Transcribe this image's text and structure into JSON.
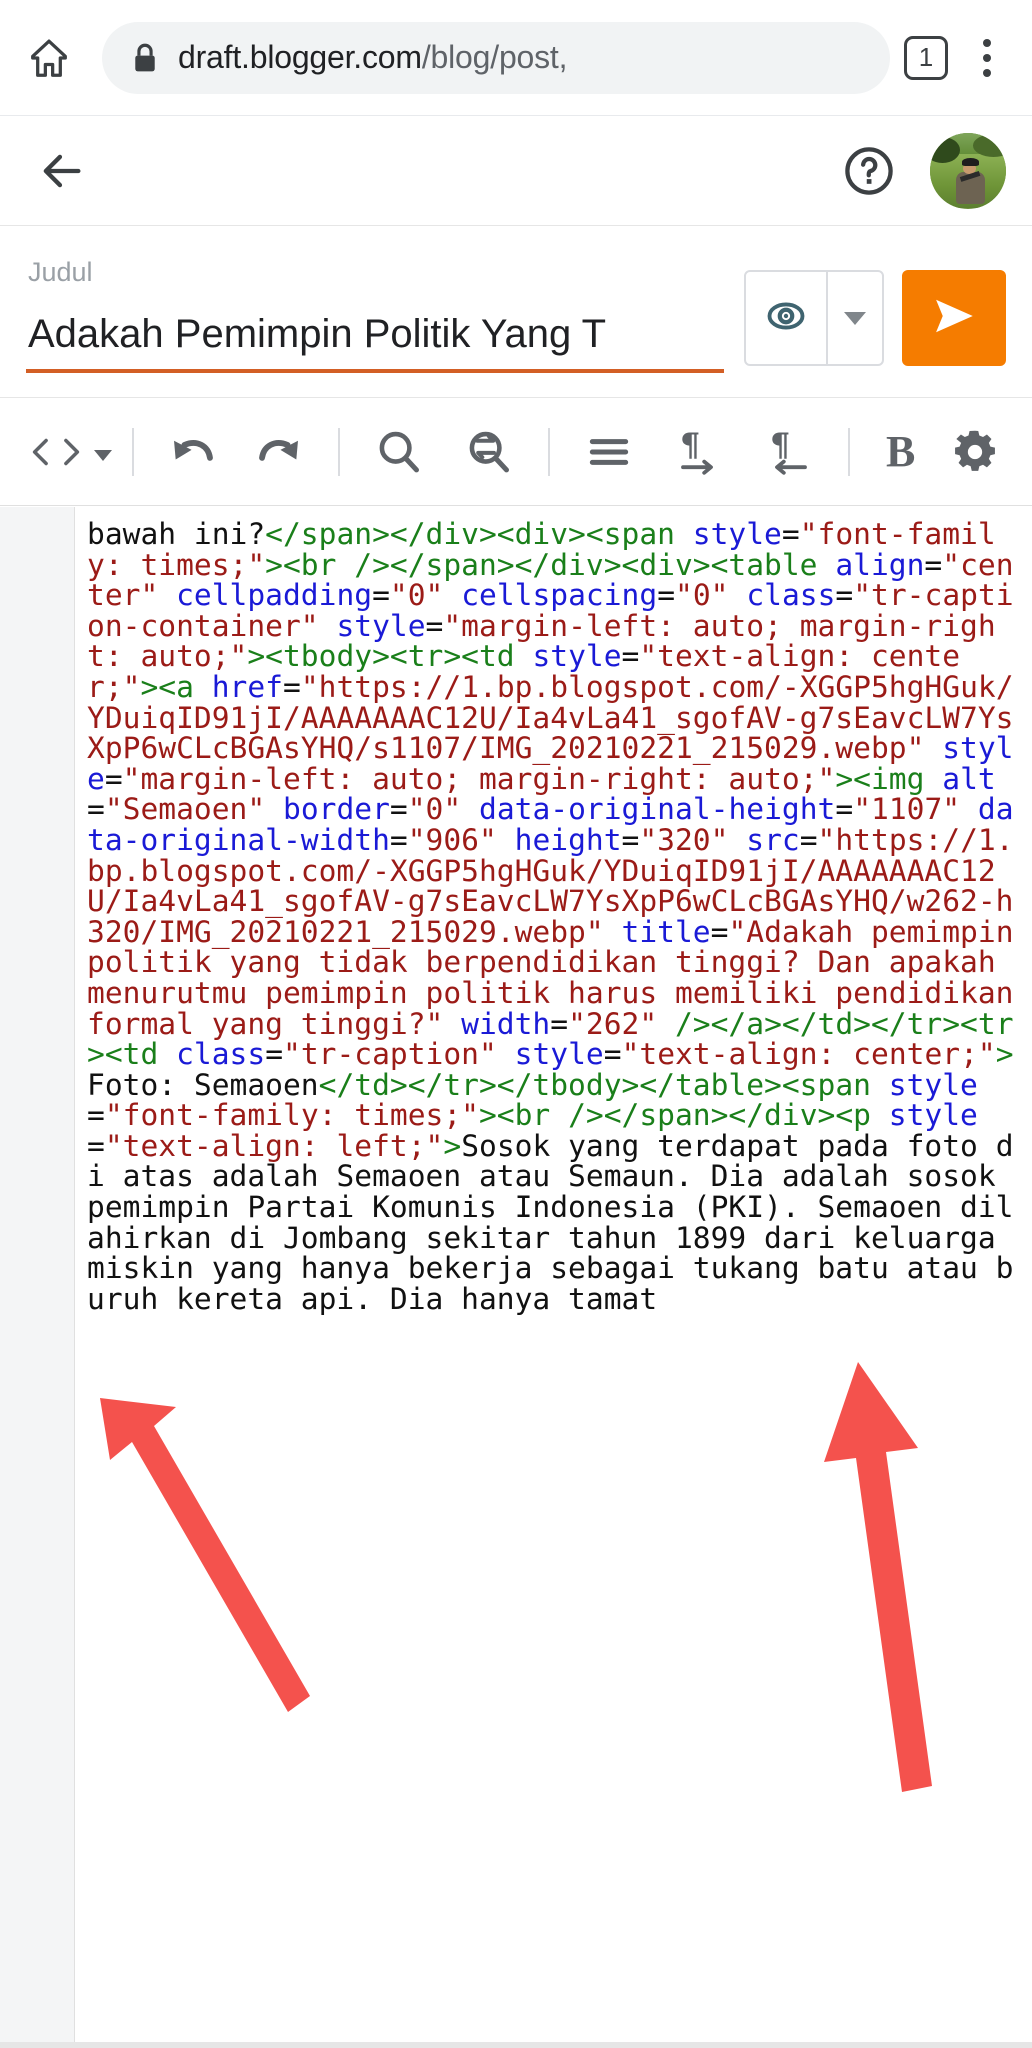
{
  "browser": {
    "home_icon": "home-icon",
    "lock_icon": "lock-icon",
    "url_host": "draft.blogger.com",
    "url_path": "/blog/post,",
    "tab_count": "1",
    "menu_icon": "kebab-menu-icon"
  },
  "app_bar": {
    "back_icon": "back-arrow-icon",
    "help_icon": "help-circle-icon",
    "avatar_label": "user-avatar"
  },
  "title": {
    "label": "Judul",
    "value": "Adakah Pemimpin Politik Yang T",
    "preview_icon": "eye-preview-icon",
    "dropdown_icon": "chevron-down-icon",
    "publish_icon": "send-publish-icon",
    "accent_color": "#d35f25",
    "publish_color": "#f57c00"
  },
  "toolbar": {
    "items": [
      {
        "name": "html-view-icon",
        "glyph": "<>"
      },
      {
        "name": "html-view-caret-icon",
        "glyph": "caret"
      },
      {
        "name": "undo-icon",
        "glyph": "undo"
      },
      {
        "name": "redo-icon",
        "glyph": "redo"
      },
      {
        "name": "search-icon",
        "glyph": "search"
      },
      {
        "name": "search-replace-icon",
        "glyph": "replace"
      },
      {
        "name": "align-icon",
        "glyph": "align"
      },
      {
        "name": "ltr-direction-icon",
        "glyph": "ltr"
      },
      {
        "name": "rtl-direction-icon",
        "glyph": "rtl"
      },
      {
        "name": "bold-icon",
        "glyph": "B"
      },
      {
        "name": "settings-gear-icon",
        "glyph": "gear"
      }
    ]
  },
  "editor": {
    "mode": "html-source",
    "tokens": [
      {
        "t": "txt",
        "s": "bawah ini?"
      },
      {
        "t": "tag",
        "s": "</span></div><div><span "
      },
      {
        "t": "attr",
        "s": "style"
      },
      {
        "t": "txt",
        "s": "="
      },
      {
        "t": "val",
        "s": "\"font-family: times;\""
      },
      {
        "t": "tag",
        "s": "><br /></span></div><div><table "
      },
      {
        "t": "attr",
        "s": "align"
      },
      {
        "t": "txt",
        "s": "="
      },
      {
        "t": "val",
        "s": "\"center\" "
      },
      {
        "t": "attr",
        "s": "cellpadding"
      },
      {
        "t": "txt",
        "s": "="
      },
      {
        "t": "val",
        "s": "\"0\" "
      },
      {
        "t": "attr",
        "s": "cellspacing"
      },
      {
        "t": "txt",
        "s": "="
      },
      {
        "t": "val",
        "s": "\"0\" "
      },
      {
        "t": "attr",
        "s": "class"
      },
      {
        "t": "txt",
        "s": "="
      },
      {
        "t": "val",
        "s": "\"tr-caption-container\" "
      },
      {
        "t": "attr",
        "s": "style"
      },
      {
        "t": "txt",
        "s": "="
      },
      {
        "t": "val",
        "s": "\"margin-left: auto; margin-right: auto;\""
      },
      {
        "t": "tag",
        "s": "><tbody><tr><td "
      },
      {
        "t": "attr",
        "s": "style"
      },
      {
        "t": "txt",
        "s": "="
      },
      {
        "t": "val",
        "s": "\"text-align: center;\""
      },
      {
        "t": "tag",
        "s": "><a "
      },
      {
        "t": "attr",
        "s": "href"
      },
      {
        "t": "txt",
        "s": "="
      },
      {
        "t": "val",
        "s": "\"https://1.bp.blogspot.com/-XGGP5hgHGuk/YDuiqID91jI/AAAAAAAC12U/Ia4vLa41_sgofAV-g7sEavcLW7YsXpP6wCLcBGAsYHQ/s1107/IMG_20210221_215029.webp\" "
      },
      {
        "t": "attr",
        "s": "style"
      },
      {
        "t": "txt",
        "s": "="
      },
      {
        "t": "val",
        "s": "\"margin-left: auto; margin-right: auto;\""
      },
      {
        "t": "tag",
        "s": "><img "
      },
      {
        "t": "attr",
        "s": "alt"
      },
      {
        "t": "txt",
        "s": "="
      },
      {
        "t": "val",
        "s": "\"Semaoen\" "
      },
      {
        "t": "attr",
        "s": "border"
      },
      {
        "t": "txt",
        "s": "="
      },
      {
        "t": "val",
        "s": "\"0\" "
      },
      {
        "t": "attr",
        "s": "data-original-height"
      },
      {
        "t": "txt",
        "s": "="
      },
      {
        "t": "val",
        "s": "\"1107\" "
      },
      {
        "t": "attr",
        "s": "data-original-width"
      },
      {
        "t": "txt",
        "s": "="
      },
      {
        "t": "val",
        "s": "\"906\" "
      },
      {
        "t": "attr",
        "s": "height"
      },
      {
        "t": "txt",
        "s": "="
      },
      {
        "t": "val",
        "s": "\"320\" "
      },
      {
        "t": "attr",
        "s": "src"
      },
      {
        "t": "txt",
        "s": "="
      },
      {
        "t": "val",
        "s": "\"https://1.bp.blogspot.com/-XGGP5hgHGuk/YDuiqID91jI/AAAAAAAC12U/Ia4vLa41_sgofAV-g7sEavcLW7YsXpP6wCLcBGAsYHQ/w262-h320/IMG_20210221_215029.webp\" "
      },
      {
        "t": "attr",
        "s": "title"
      },
      {
        "t": "txt",
        "s": "="
      },
      {
        "t": "val",
        "s": "\"Adakah pemimpin politik yang tidak berpendidikan tinggi? Dan apakah menurutmu pemimpin politik harus memiliki pendidikan formal yang tinggi?\" "
      },
      {
        "t": "attr",
        "s": "width"
      },
      {
        "t": "txt",
        "s": "="
      },
      {
        "t": "val",
        "s": "\"262\" "
      },
      {
        "t": "tag",
        "s": "/></a></td></tr><tr><td "
      },
      {
        "t": "attr",
        "s": "class"
      },
      {
        "t": "txt",
        "s": "="
      },
      {
        "t": "val",
        "s": "\"tr-caption\" "
      },
      {
        "t": "attr",
        "s": "style"
      },
      {
        "t": "txt",
        "s": "="
      },
      {
        "t": "val",
        "s": "\"text-align: center;\""
      },
      {
        "t": "tag",
        "s": ">"
      },
      {
        "t": "txt",
        "s": "Foto: Semaoen"
      },
      {
        "t": "tag",
        "s": "</td></tr></tbody></table><span "
      },
      {
        "t": "attr",
        "s": "style"
      },
      {
        "t": "txt",
        "s": "="
      },
      {
        "t": "val",
        "s": "\"font-family: times;\""
      },
      {
        "t": "tag",
        "s": "><br /></span></div><p "
      },
      {
        "t": "attr",
        "s": "style"
      },
      {
        "t": "txt",
        "s": "="
      },
      {
        "t": "val",
        "s": "\"text-align: left;\""
      },
      {
        "t": "tag",
        "s": ">"
      },
      {
        "t": "txt",
        "s": "Sosok yang terdapat pada foto di atas adalah Semaoen atau Semaun. Dia adalah sosok pemimpin Partai Komunis Indonesia (PKI). Semaoen dilahirkan di Jombang sekitar tahun 1899 dari keluarga miskin yang hanya bekerja sebagai tukang batu atau buruh kereta api. Dia hanya tamat"
      }
    ],
    "colors": {
      "tag": "#1a7f1a",
      "attribute": "#1a1ad6",
      "value": "#9b1b17",
      "text": "#111111",
      "gutter": "#f4f5f6"
    }
  },
  "annotations": {
    "arrow_color": "#f4524d",
    "arrows": [
      {
        "name": "arrow-pointing-to-w262-h320-left",
        "direction": "up-left"
      },
      {
        "name": "arrow-pointing-to-w262-h320-right",
        "direction": "up"
      }
    ]
  }
}
